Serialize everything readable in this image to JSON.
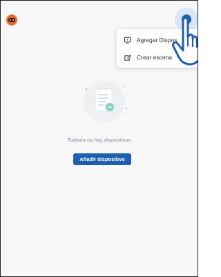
{
  "header": {
    "add_icon": "plus-icon",
    "add_glyph": "+"
  },
  "menu": {
    "items": [
      {
        "label": "Agregar Dispos",
        "icon": "device-icon"
      },
      {
        "label": "Crear escena",
        "icon": "scene-icon"
      }
    ]
  },
  "empty_state": {
    "message": "Todavía no hay dispositivos",
    "button_label": "Añadir dispositivo"
  },
  "colors": {
    "accent": "#1f5fb2",
    "logo": "#f0672a",
    "background": "#f7f7f8"
  }
}
